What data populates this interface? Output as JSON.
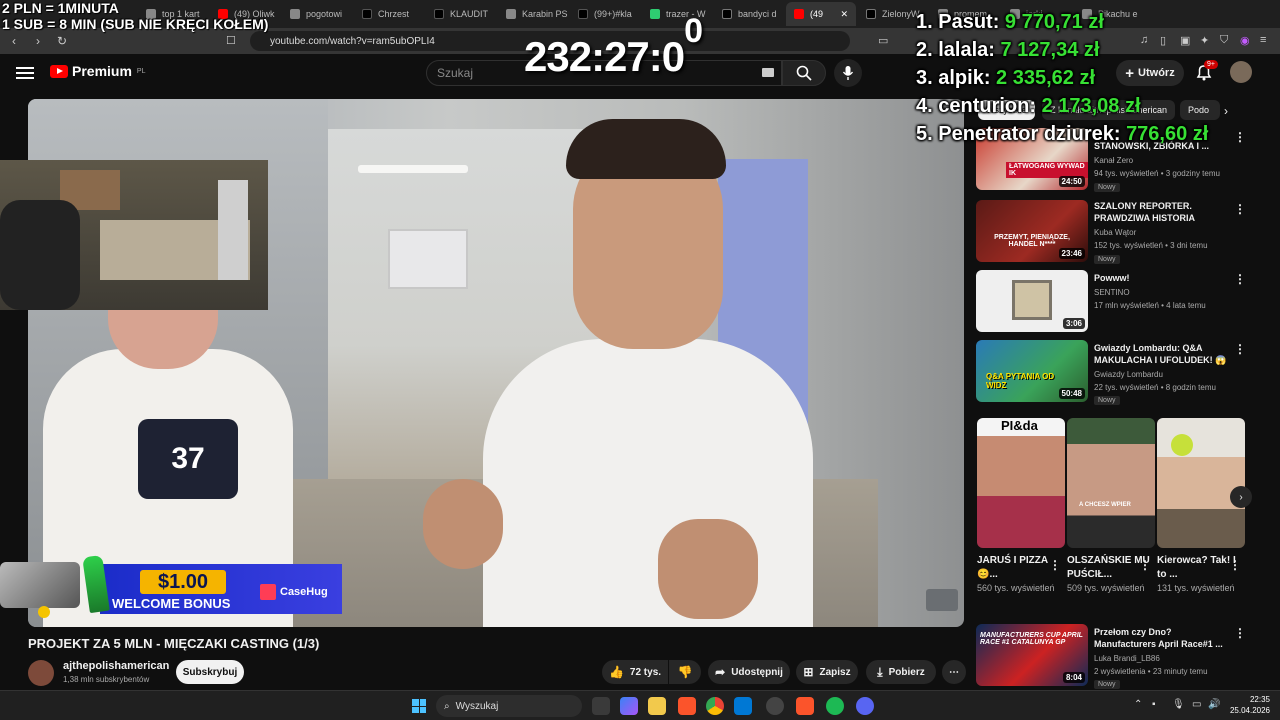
{
  "overlay": {
    "rate_line1": "2 PLN =  1MINUTA",
    "rate_line2": "1 SUB = 8 MIN (SUB NIE KRĘCI KOŁEM)",
    "timer_main": "232:27:0",
    "timer_sup": "0",
    "leaderboard": [
      {
        "rank_name": "1. Pasut: ",
        "amount": "9 770,71 zł"
      },
      {
        "rank_name": "2. lalala: ",
        "amount": "7 127,34 zł"
      },
      {
        "rank_name": "3. alpik: ",
        "amount": "2 335,62 zł"
      },
      {
        "rank_name": "4. centurion: ",
        "amount": "2 173,08 zł"
      },
      {
        "rank_name": "5. Penetrator dziurek: ",
        "amount": "776,60 zł"
      }
    ]
  },
  "browser": {
    "tabs": [
      {
        "label": "top 1 kart"
      },
      {
        "label": "(49) Oliwk"
      },
      {
        "label": "pogotowi"
      },
      {
        "label": "Chrzest"
      },
      {
        "label": "KLAUDIT"
      },
      {
        "label": "Karabin PS"
      },
      {
        "label": "(99+)#kla"
      },
      {
        "label": "trazer - W"
      },
      {
        "label": "bandyci d"
      },
      {
        "label": "(49"
      },
      {
        "label": "ZielonyW"
      },
      {
        "label": "promem"
      },
      {
        "label": "jorki"
      },
      {
        "label": "Pikachu e"
      }
    ],
    "url": "youtube.com/watch?v=ram5ubOPLI4"
  },
  "youtube": {
    "logo_text": "Premium",
    "logo_region": "PL",
    "search_placeholder": "Szukaj",
    "create_label": "Utwórz",
    "notif_count": "9+",
    "video_title": "PROJEKT ZA 5 MLN - MIĘCZAKI CASTING (1/3)",
    "channel_name": "ajthepolishamerican",
    "channel_subs": "1,38 mln subskrybentów",
    "subscribe_label": "Subskrybuj",
    "likes": "72 tys.",
    "share_label": "Udostępnij",
    "save_label": "Zapisz",
    "download_label": "Pobierz",
    "more_label": "⋯",
    "player_number": "37"
  },
  "ad": {
    "price": "$1.00",
    "bonus": "WELCOME BONUS",
    "brand": "CaseHug"
  },
  "sidebar": {
    "chips": [
      {
        "label": "Wszystkie"
      },
      {
        "label": "Z kanału ajthepolishamerican"
      },
      {
        "label": "Podo"
      }
    ],
    "recs": [
      {
        "title": "STANOWSKI, ZBIÓRKA I ...",
        "channel": "Kanał Zero",
        "meta": "94 tys. wyświetleń • 3 godziny temu",
        "badge": "Nowy",
        "duration": "24:50",
        "thumb_text": "ŁATWOGANG WYWAD IK"
      },
      {
        "title": "SZALONY REPORTER. PRAWDZIWA HISTORIA",
        "channel": "Kuba Wątor",
        "meta": "152 tys. wyświetleń • 3 dni temu",
        "badge": "Nowy",
        "duration": "23:46",
        "thumb_text": "PRZEMYT, PIENIĄDZE, HANDEL N****"
      },
      {
        "title": "Powww!",
        "channel": "SENTINO",
        "meta": "17 mln wyświetleń • 4 lata temu",
        "badge": "",
        "duration": "3:06",
        "thumb_text": ""
      },
      {
        "title": "Gwiazdy Lombardu: Q&A MAKULACHA I UFOLUDEK! 😱",
        "channel": "Gwiazdy Lombardu",
        "meta": "22 tys. wyświetleń • 8 godzin temu",
        "badge": "Nowy",
        "duration": "50:48",
        "thumb_text": "Q&A PYTANIA OD WIDZ"
      },
      {
        "title": "Przełom czy Dno? Manufacturers April Race#1 ...",
        "channel": "Luka Brandi_LB86",
        "meta": "2 wyświetlenia • 23 minuty temu",
        "badge": "Nowy",
        "duration": "8:04",
        "thumb_text": "MANUFACTURERS CUP APRIL RACE #1 CATALUNYA GP"
      }
    ],
    "shorts": [
      {
        "title": "JARUŚ I PIZZA 😊...",
        "views": "560 tys. wyświetleń",
        "thumb_text": "PI&da"
      },
      {
        "title": "OLSZAŃSKIE MU PUŚCIŁ...",
        "views": "509 tys. wyświetleń",
        "thumb_text": "A CHCESZ WPIER"
      },
      {
        "title": "Kierowca? Tak! I to ...",
        "views": "131 tys. wyświetleń",
        "thumb_text": ""
      }
    ]
  },
  "taskbar": {
    "search_label": "Wyszukaj",
    "time": "22:35",
    "date": "25.04.2026"
  }
}
